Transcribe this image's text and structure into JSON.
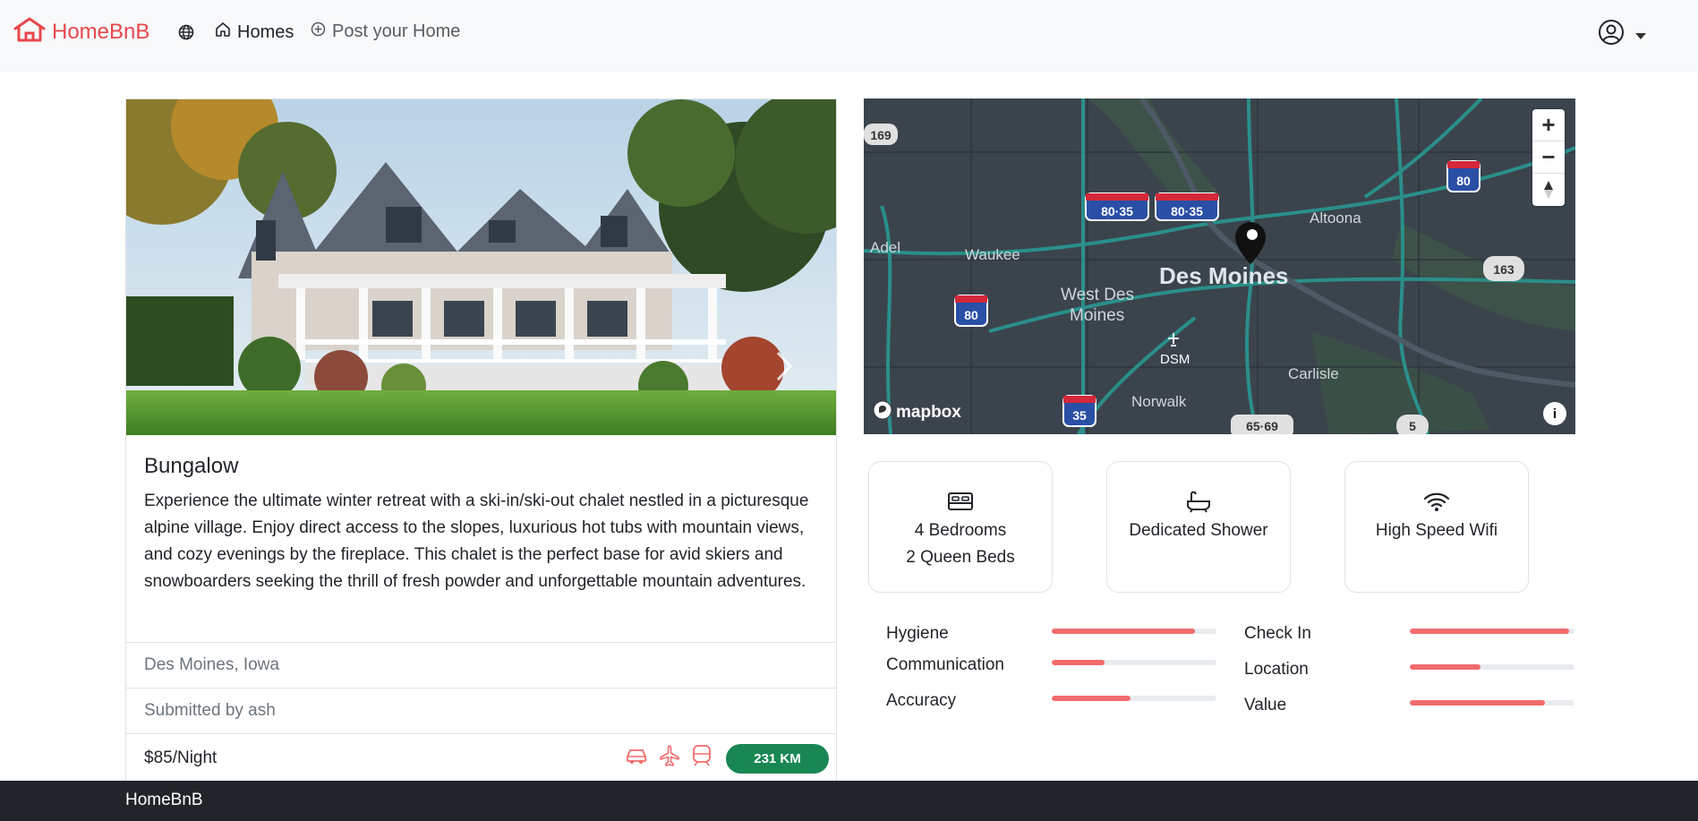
{
  "navbar": {
    "brand": "HomeBnB",
    "links": [
      {
        "label": "Homes",
        "icon": "home-icon"
      },
      {
        "label": "Post your Home",
        "icon": "plus-circle-icon"
      }
    ],
    "globe_icon": "globe-icon",
    "user_icon": "user-circle-icon",
    "brand_color": "#e8474d"
  },
  "listing": {
    "title": "Bungalow",
    "description": "Experience the ultimate winter retreat with a ski-in/ski-out chalet nestled in a picturesque alpine village. Enjoy direct access to the slopes, luxurious hot tubs with mountain views, and cozy evenings by the fireplace. This chalet is the perfect base for avid skiers and snowboarders seeking the thrill of fresh powder and unforgettable mountain adventures.",
    "location": "Des Moines, Iowa",
    "submitted_by": "Submitted by ash",
    "price": "$85/Night",
    "distance": "231 KM",
    "transport_icons": [
      "car-icon",
      "plane-icon",
      "train-icon"
    ]
  },
  "map": {
    "city": "Des Moines",
    "places": [
      "Waukee",
      "West Des",
      "Moines",
      "Altoona",
      "Carlisle",
      "Norwalk",
      "Adel",
      "DSM"
    ],
    "highways": [
      "169",
      "80",
      "80-35",
      "80-35",
      "163",
      "35",
      "65-69",
      "5",
      "80"
    ],
    "attribution": "mapbox",
    "zoom_in": "+",
    "zoom_out": "−",
    "background": "#3b444d",
    "road_color": "#2a8f8a"
  },
  "amenities": [
    {
      "icon": "bed-icon",
      "line1": "4 Bedrooms",
      "line2": "2 Queen Beds"
    },
    {
      "icon": "bathtub-icon",
      "line1": "Dedicated Shower",
      "line2": ""
    },
    {
      "icon": "wifi-icon",
      "line1": "High Speed Wifi",
      "line2": ""
    }
  ],
  "ratings": {
    "left": [
      {
        "label": "Hygiene",
        "value": 0.87
      },
      {
        "label": "Communication",
        "value": 0.32
      },
      {
        "label": "Accuracy",
        "value": 0.48
      }
    ],
    "right": [
      {
        "label": "Check In",
        "value": 0.97
      },
      {
        "label": "Location",
        "value": 0.43
      },
      {
        "label": "Value",
        "value": 0.82
      }
    ],
    "bar_color": "#f26b6d"
  },
  "footer": {
    "brand": "HomeBnB"
  }
}
